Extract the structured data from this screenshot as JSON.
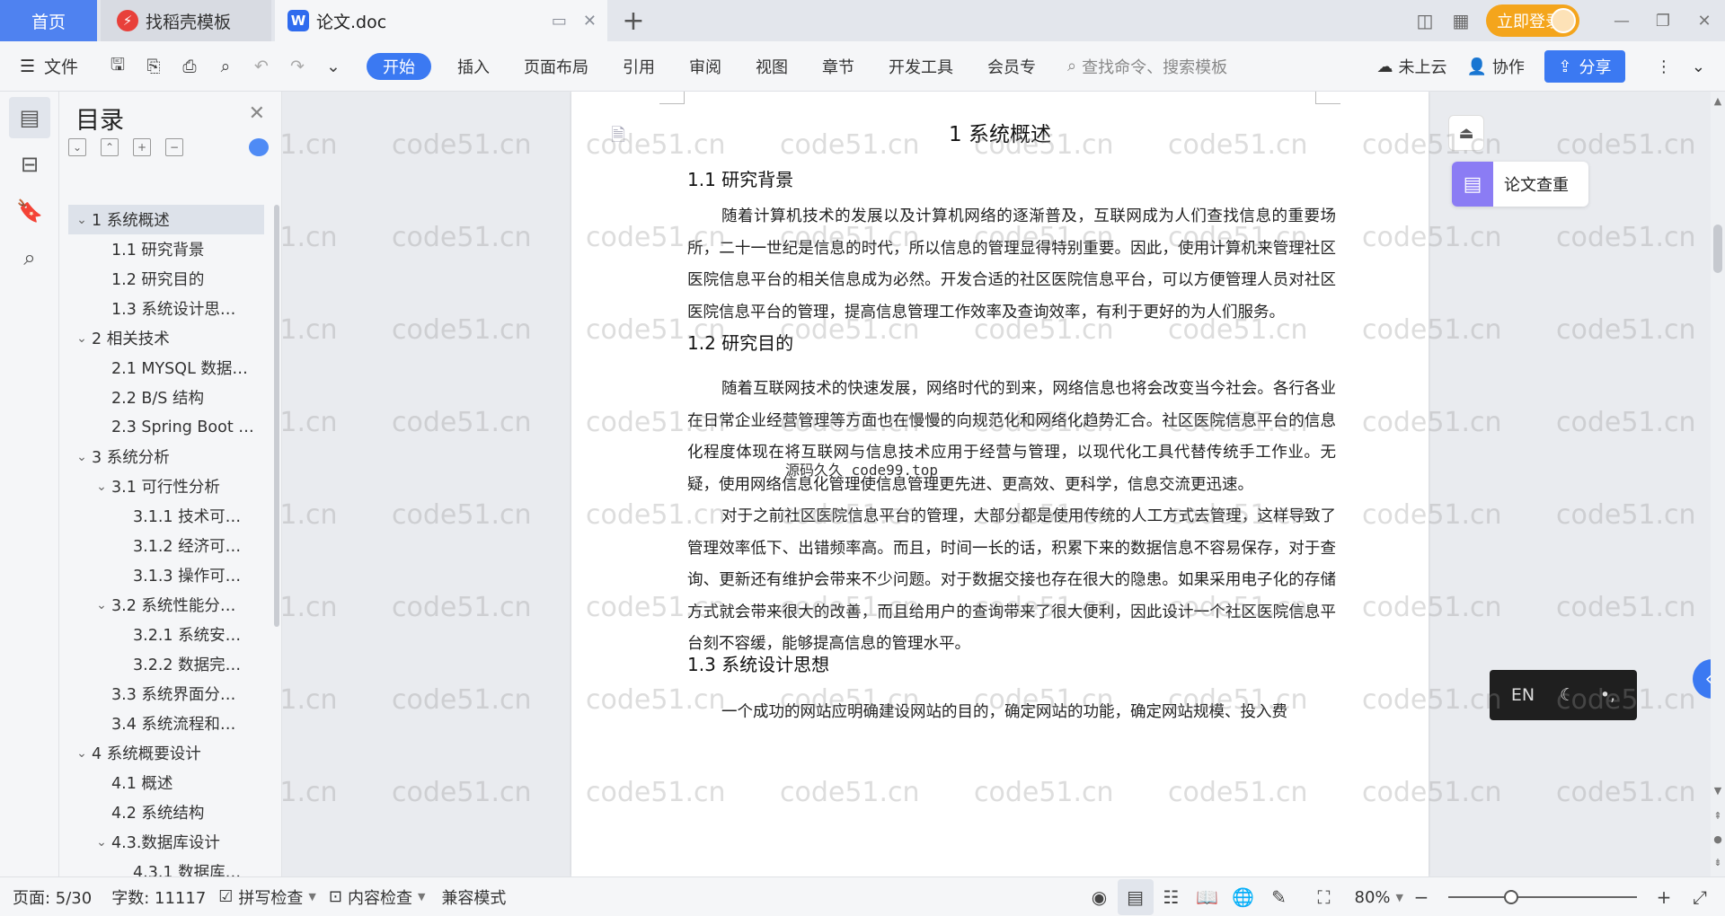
{
  "tabs": {
    "home": "首页",
    "template": "找稻壳模板",
    "doc": "论文.doc",
    "login": "立即登录"
  },
  "menu": {
    "file": "文件",
    "tabs": [
      "开始",
      "插入",
      "页面布局",
      "引用",
      "审阅",
      "视图",
      "章节",
      "开发工具",
      "会员专"
    ],
    "search_placeholder": "查找命令、搜索模板",
    "cloud": "未上云",
    "collab": "协作",
    "share": "分享"
  },
  "toc": {
    "title": "目录",
    "items": [
      {
        "label": "1 系统概述",
        "level": "lv1",
        "chev": "⌄"
      },
      {
        "label": "1.1  研究背景",
        "level": "lv2",
        "chev": ""
      },
      {
        "label": "1.2 研究目的",
        "level": "lv2",
        "chev": ""
      },
      {
        "label": "1.3 系统设计思…",
        "level": "lv2",
        "chev": ""
      },
      {
        "label": "2 相关技术",
        "level": "lv1",
        "chev": "⌄"
      },
      {
        "label": "2.1 MYSQL 数据…",
        "level": "lv2",
        "chev": ""
      },
      {
        "label": "2.2 B/S 结构",
        "level": "lv2",
        "chev": ""
      },
      {
        "label": "2.3 Spring Boot …",
        "level": "lv2",
        "chev": ""
      },
      {
        "label": "3 系统分析",
        "level": "lv1",
        "chev": "⌄"
      },
      {
        "label": "3.1 可行性分析",
        "level": "lv2c",
        "chev": "⌄"
      },
      {
        "label": "3.1.1 技术可…",
        "level": "lv3",
        "chev": ""
      },
      {
        "label": "3.1.2 经济可…",
        "level": "lv3",
        "chev": ""
      },
      {
        "label": "3.1.3 操作可…",
        "level": "lv3",
        "chev": ""
      },
      {
        "label": "3.2 系统性能分…",
        "level": "lv2c",
        "chev": "⌄"
      },
      {
        "label": "3.2.1  系统安…",
        "level": "lv3",
        "chev": ""
      },
      {
        "label": "3.2.2  数据完…",
        "level": "lv3",
        "chev": ""
      },
      {
        "label": "3.3 系统界面分…",
        "level": "lv2",
        "chev": ""
      },
      {
        "label": "3.4 系统流程和…",
        "level": "lv2",
        "chev": ""
      },
      {
        "label": "4 系统概要设计",
        "level": "lv1",
        "chev": "⌄"
      },
      {
        "label": "4.1 概述",
        "level": "lv2",
        "chev": ""
      },
      {
        "label": "4.2 系统结构",
        "level": "lv2",
        "chev": ""
      },
      {
        "label": "4.3.数据库设计",
        "level": "lv2c",
        "chev": "⌄"
      },
      {
        "label": "4.3.1 数据库…",
        "level": "lv3",
        "chev": ""
      }
    ]
  },
  "document": {
    "h1": "1 系统概述",
    "h2_1": "1.1  研究背景",
    "p1": "随着计算机技术的发展以及计算机网络的逐渐普及，互联网成为人们查找信息的重要场所，二十一世纪是信息的时代，所以信息的管理显得特别重要。因此，使用计算机来管理社区医院信息平台的相关信息成为必然。开发合适的社区医院信息平台，可以方便管理人员对社区医院信息平台的管理，提高信息管理工作效率及查询效率，有利于更好的为人们服务。",
    "h2_2": "1.2 研究目的",
    "p2": "随着互联网技术的快速发展，网络时代的到来，网络信息也将会改变当今社会。各行各业在日常企业经营管理等方面也在慢慢的向规范化和网络化趋势汇合。社区医院信息平台的信息化程度体现在将互联网与信息技术应用于经营与管理，以现代化工具代替传统手工作业。无疑，使用网络信息化管理使信息管理更先进、更高效、更科学，信息交流更迅速。",
    "p3": "对于之前社区医院信息平台的管理，大部分都是使用传统的人工方式去管理，这样导致了管理效率低下、出错频率高。而且，时间一长的话，积累下来的数据信息不容易保存，对于查询、更新还有维护会带来不少问题。对于数据交接也存在很大的隐患。如果采用电子化的存储方式就会带来很大的改善，而且给用户的查询带来了很大便利，因此设计一个社区医院信息平台刻不容缓，能够提高信息的管理水平。",
    "h2_3": "1.3 系统设计思想",
    "p4": "一个成功的网站应明确建设网站的目的，确定网站的功能，确定网站规模、投入费",
    "overlay_text": "源码久久 code99.top"
  },
  "side": {
    "check_label": "论文查重",
    "ime_lang": "EN"
  },
  "status": {
    "page": "页面: 5/30",
    "words": "字数: 11117",
    "spell": "拼写检查",
    "content": "内容检查",
    "compat": "兼容模式",
    "zoom": "80%",
    "zoom_level": 0.32
  },
  "watermark": "code51.cn"
}
